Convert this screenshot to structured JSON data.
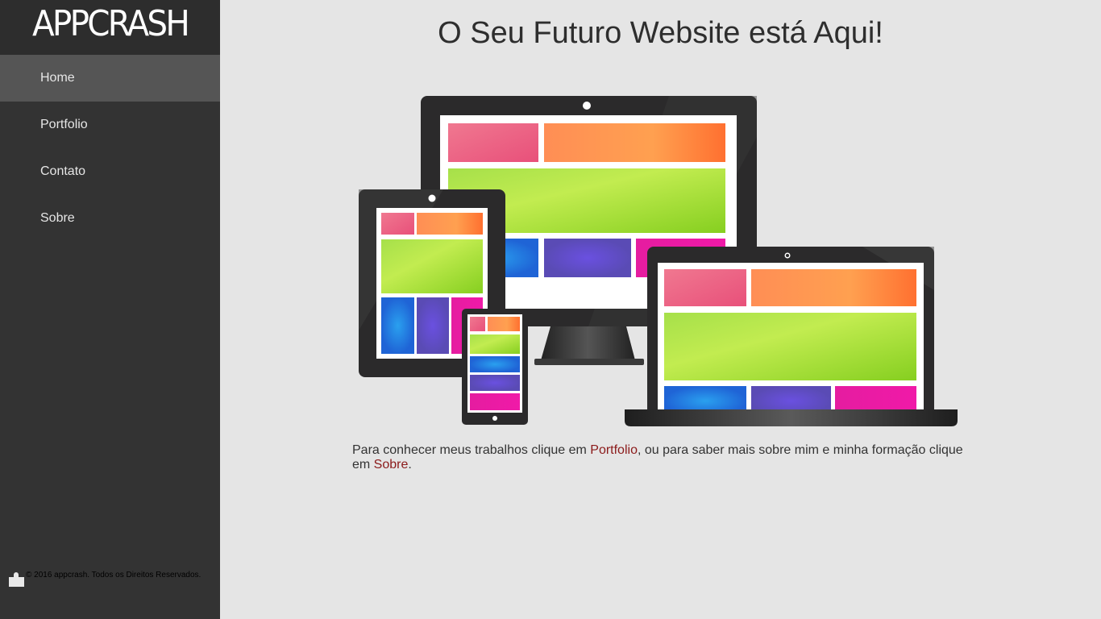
{
  "sidebar": {
    "logo": "APPCRASH",
    "items": [
      {
        "label": "Home",
        "active": true
      },
      {
        "label": "Portfolio",
        "active": false
      },
      {
        "label": "Contato",
        "active": false
      },
      {
        "label": "Sobre",
        "active": false
      }
    ],
    "footer": "© 2016 appcrash. Todos os Direitos Reservados."
  },
  "main": {
    "title": "O Seu Futuro Website está Aqui!",
    "intro": {
      "part1": "Para conhecer meus trabalhos clique em ",
      "link1": "Portfolio",
      "part2": ", ou para saber mais sobre mim e minha formação clique em ",
      "link2": "Sobre",
      "part3": "."
    }
  },
  "colors": {
    "sidebar_bg": "#333333",
    "active_item": "#555555",
    "page_bg": "#e5e5e5",
    "link": "#8b1a1a"
  },
  "icons": [
    "puzzle-icon"
  ]
}
